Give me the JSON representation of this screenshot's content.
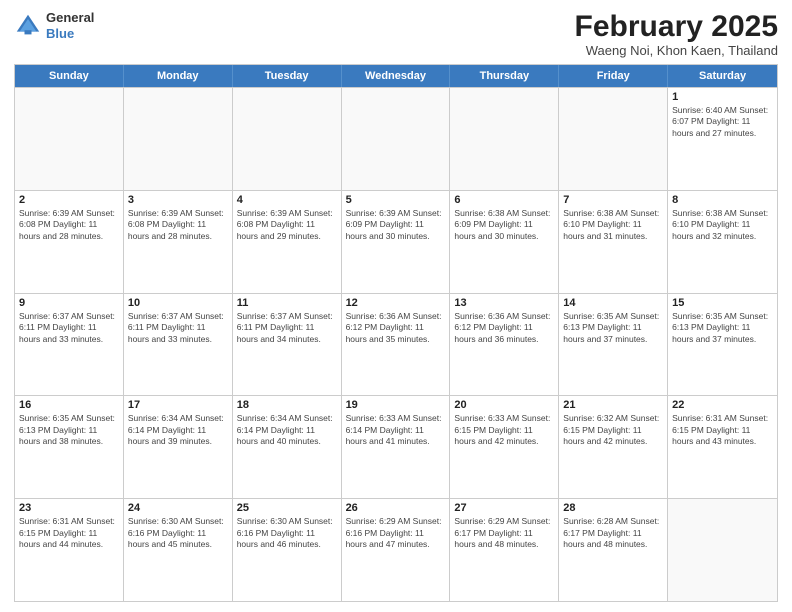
{
  "header": {
    "logo_general": "General",
    "logo_blue": "Blue",
    "month_title": "February 2025",
    "location": "Waeng Noi, Khon Kaen, Thailand"
  },
  "calendar": {
    "days_of_week": [
      "Sunday",
      "Monday",
      "Tuesday",
      "Wednesday",
      "Thursday",
      "Friday",
      "Saturday"
    ],
    "rows": [
      [
        {
          "day": "",
          "info": ""
        },
        {
          "day": "",
          "info": ""
        },
        {
          "day": "",
          "info": ""
        },
        {
          "day": "",
          "info": ""
        },
        {
          "day": "",
          "info": ""
        },
        {
          "day": "",
          "info": ""
        },
        {
          "day": "1",
          "info": "Sunrise: 6:40 AM\nSunset: 6:07 PM\nDaylight: 11 hours and 27 minutes."
        }
      ],
      [
        {
          "day": "2",
          "info": "Sunrise: 6:39 AM\nSunset: 6:08 PM\nDaylight: 11 hours and 28 minutes."
        },
        {
          "day": "3",
          "info": "Sunrise: 6:39 AM\nSunset: 6:08 PM\nDaylight: 11 hours and 28 minutes."
        },
        {
          "day": "4",
          "info": "Sunrise: 6:39 AM\nSunset: 6:08 PM\nDaylight: 11 hours and 29 minutes."
        },
        {
          "day": "5",
          "info": "Sunrise: 6:39 AM\nSunset: 6:09 PM\nDaylight: 11 hours and 30 minutes."
        },
        {
          "day": "6",
          "info": "Sunrise: 6:38 AM\nSunset: 6:09 PM\nDaylight: 11 hours and 30 minutes."
        },
        {
          "day": "7",
          "info": "Sunrise: 6:38 AM\nSunset: 6:10 PM\nDaylight: 11 hours and 31 minutes."
        },
        {
          "day": "8",
          "info": "Sunrise: 6:38 AM\nSunset: 6:10 PM\nDaylight: 11 hours and 32 minutes."
        }
      ],
      [
        {
          "day": "9",
          "info": "Sunrise: 6:37 AM\nSunset: 6:11 PM\nDaylight: 11 hours and 33 minutes."
        },
        {
          "day": "10",
          "info": "Sunrise: 6:37 AM\nSunset: 6:11 PM\nDaylight: 11 hours and 33 minutes."
        },
        {
          "day": "11",
          "info": "Sunrise: 6:37 AM\nSunset: 6:11 PM\nDaylight: 11 hours and 34 minutes."
        },
        {
          "day": "12",
          "info": "Sunrise: 6:36 AM\nSunset: 6:12 PM\nDaylight: 11 hours and 35 minutes."
        },
        {
          "day": "13",
          "info": "Sunrise: 6:36 AM\nSunset: 6:12 PM\nDaylight: 11 hours and 36 minutes."
        },
        {
          "day": "14",
          "info": "Sunrise: 6:35 AM\nSunset: 6:13 PM\nDaylight: 11 hours and 37 minutes."
        },
        {
          "day": "15",
          "info": "Sunrise: 6:35 AM\nSunset: 6:13 PM\nDaylight: 11 hours and 37 minutes."
        }
      ],
      [
        {
          "day": "16",
          "info": "Sunrise: 6:35 AM\nSunset: 6:13 PM\nDaylight: 11 hours and 38 minutes."
        },
        {
          "day": "17",
          "info": "Sunrise: 6:34 AM\nSunset: 6:14 PM\nDaylight: 11 hours and 39 minutes."
        },
        {
          "day": "18",
          "info": "Sunrise: 6:34 AM\nSunset: 6:14 PM\nDaylight: 11 hours and 40 minutes."
        },
        {
          "day": "19",
          "info": "Sunrise: 6:33 AM\nSunset: 6:14 PM\nDaylight: 11 hours and 41 minutes."
        },
        {
          "day": "20",
          "info": "Sunrise: 6:33 AM\nSunset: 6:15 PM\nDaylight: 11 hours and 42 minutes."
        },
        {
          "day": "21",
          "info": "Sunrise: 6:32 AM\nSunset: 6:15 PM\nDaylight: 11 hours and 42 minutes."
        },
        {
          "day": "22",
          "info": "Sunrise: 6:31 AM\nSunset: 6:15 PM\nDaylight: 11 hours and 43 minutes."
        }
      ],
      [
        {
          "day": "23",
          "info": "Sunrise: 6:31 AM\nSunset: 6:15 PM\nDaylight: 11 hours and 44 minutes."
        },
        {
          "day": "24",
          "info": "Sunrise: 6:30 AM\nSunset: 6:16 PM\nDaylight: 11 hours and 45 minutes."
        },
        {
          "day": "25",
          "info": "Sunrise: 6:30 AM\nSunset: 6:16 PM\nDaylight: 11 hours and 46 minutes."
        },
        {
          "day": "26",
          "info": "Sunrise: 6:29 AM\nSunset: 6:16 PM\nDaylight: 11 hours and 47 minutes."
        },
        {
          "day": "27",
          "info": "Sunrise: 6:29 AM\nSunset: 6:17 PM\nDaylight: 11 hours and 48 minutes."
        },
        {
          "day": "28",
          "info": "Sunrise: 6:28 AM\nSunset: 6:17 PM\nDaylight: 11 hours and 48 minutes."
        },
        {
          "day": "",
          "info": ""
        }
      ]
    ]
  }
}
